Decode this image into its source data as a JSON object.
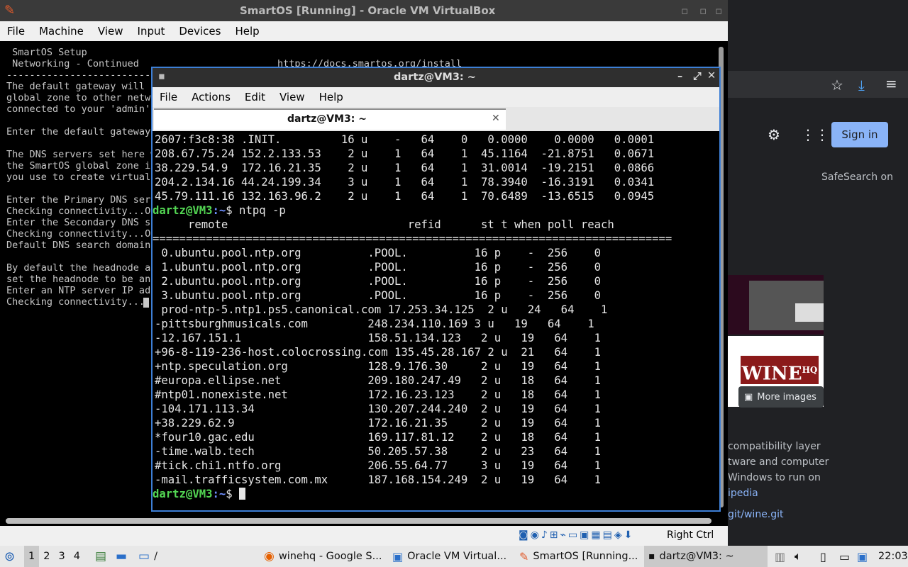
{
  "browser": {
    "signin": "Sign in",
    "safesearch": "SafeSearch on",
    "more_images": "More images",
    "desc_lines": [
      "compatibility layer",
      "tware and computer",
      "Windows to run on",
      "ipedia"
    ],
    "link": "git/wine.git",
    "thumb_text": "WINE",
    "thumb_sup": "HQ"
  },
  "vbox": {
    "title": "SmartOS [Running] - Oracle VM VirtualBox",
    "menu": [
      "File",
      "Machine",
      "View",
      "Input",
      "Devices",
      "Help"
    ],
    "status_right": "Right Ctrl",
    "console_lines": [
      " SmartOS Setup",
      " Networking - Continued                        https://docs.smartos.org/install",
      "----------------------------------------------------------------------------",
      "The default gateway will d",
      "global zone to other netwo",
      "connected to your 'admin'",
      "",
      "Enter the default gateway",
      "",
      "The DNS servers set here w",
      "the SmartOS global zone if",
      "you use to create virtual",
      "",
      "Enter the Primary DNS serv",
      "Checking connectivity...OK",
      "Enter the Secondary DNS se",
      "Checking connectivity...OK",
      "Default DNS search domain",
      "",
      "By default the headnode ac",
      "set the headnode to be an",
      "Enter an NTP server IP add",
      "Checking connectivity..."
    ]
  },
  "terminal": {
    "title": "dartz@VM3: ~",
    "menu": [
      "File",
      "Actions",
      "Edit",
      "View",
      "Help"
    ],
    "tab_title": "dartz@VM3: ~",
    "prompt_user": "dartz@VM3",
    "prompt_path": ":~",
    "prompt_symbol": "$ ",
    "command": "ntpq -p",
    "prev_lines": [
      "2607:f3c8:38 .INIT.         16 u    -   64    0   0.0000    0.0000   0.0001",
      "208.67.75.24 152.2.133.53    2 u    1   64    1  45.1164  -21.8751   0.0671",
      "38.229.54.9  172.16.21.35    2 u    1   64    1  31.0014  -19.2151   0.0866",
      "204.2.134.16 44.24.199.34    3 u    1   64    1  78.3940  -16.3191   0.0341",
      "45.79.111.16 132.163.96.2    2 u    1   64    1  70.6489  -13.6515   0.0945"
    ],
    "header": "     remote                           refid      st t when poll reach",
    "separator": "==============================================================================",
    "rows": [
      " 0.ubuntu.pool.ntp.org          .POOL.          16 p    -  256    0",
      " 1.ubuntu.pool.ntp.org          .POOL.          16 p    -  256    0",
      " 2.ubuntu.pool.ntp.org          .POOL.          16 p    -  256    0",
      " 3.ubuntu.pool.ntp.org          .POOL.          16 p    -  256    0",
      " prod-ntp-5.ntp1.ps5.canonical.com 17.253.34.125  2 u   24   64    1",
      "-pittsburghmusicals.com         248.234.110.169 3 u   19   64    1",
      "-12.167.151.1                   158.51.134.123   2 u   19   64    1",
      "+96-8-119-236-host.colocrossing.com 135.45.28.167 2 u  21   64    1",
      "+ntp.speculation.org            128.9.176.30     2 u   19   64    1",
      "#europa.ellipse.net             209.180.247.49   2 u   18   64    1",
      "#ntp01.nonexiste.net            172.16.23.123    2 u   18   64    1",
      "-104.171.113.34                 130.207.244.240  2 u   19   64    1",
      "+38.229.62.9                    172.16.21.35     2 u   19   64    1",
      "*four10.gac.edu                 169.117.81.12    2 u   18   64    1",
      "-time.walb.tech                 50.205.57.38     2 u   23   64    1",
      "#tick.chi1.ntfo.org             206.55.64.77     3 u   19   64    1",
      "-mail.trafficsystem.com.mx      187.168.154.249  2 u   19   64    1"
    ]
  },
  "taskbar": {
    "workspaces": [
      "1",
      "2",
      "3",
      "4"
    ],
    "folder_label": "/",
    "tasks": [
      "winehq - Google S...",
      "Oracle VM Virtual...",
      "SmartOS [Running...",
      "dartz@VM3: ~"
    ],
    "clock": "22:03"
  }
}
